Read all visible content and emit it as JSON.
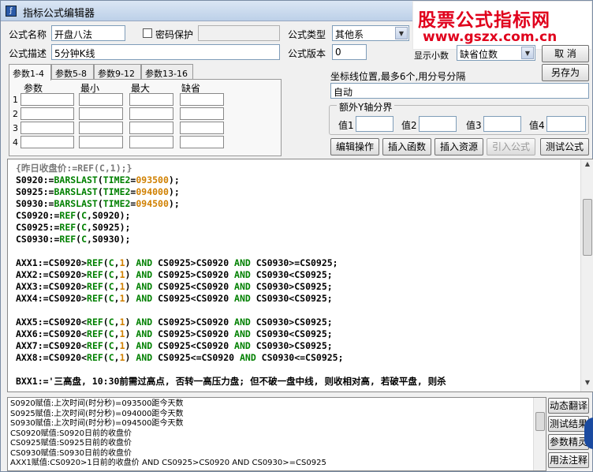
{
  "window": {
    "title": "指标公式编辑器"
  },
  "watermark": {
    "line1": "股票公式指标网",
    "line2": "www.gszx.com.cn"
  },
  "form": {
    "name_label": "公式名称",
    "name_value": "开盘八法",
    "password_label": "密码保护",
    "type_label": "公式类型",
    "type_value": "其他系",
    "desc_label": "公式描述",
    "desc_value": "5分钟K线",
    "version_label": "公式版本",
    "version_value": "0",
    "decimals_label": "显示小数",
    "decimals_value": "缺省位数",
    "cancel_label": "取 消",
    "saveas_label": "另存为"
  },
  "tabs": [
    {
      "label": "参数1-4"
    },
    {
      "label": "参数5-8"
    },
    {
      "label": "参数9-12"
    },
    {
      "label": "参数13-16"
    }
  ],
  "params": {
    "headers": [
      "参数",
      "最小",
      "最大",
      "缺省"
    ],
    "rows": [
      "1",
      "2",
      "3",
      "4"
    ]
  },
  "axis": {
    "label": "坐标线位置,最多6个,用分号分隔",
    "value": "自动",
    "extra_title": "额外Y轴分界",
    "v1": "值1",
    "v2": "值2",
    "v3": "值3",
    "v4": "值4"
  },
  "buttons": {
    "edit": "编辑操作",
    "insert_func": "插入函数",
    "insert_res": "插入资源",
    "import": "引入公式",
    "test": "测试公式"
  },
  "code": {
    "lines": [
      "{昨日收盘价:=REF(C,1);}",
      "S0920:=BARSLAST(TIME2=093500);",
      "S0925:=BARSLAST(TIME2=094000);",
      "S0930:=BARSLAST(TIME2=094500);",
      "CS0920:=REF(C,S0920);",
      "CS0925:=REF(C,S0925);",
      "CS0930:=REF(C,S0930);",
      "",
      "AXX1:=CS0920>REF(C,1) AND CS0925>CS0920 AND CS0930>=CS0925;",
      "AXX2:=CS0920>REF(C,1) AND CS0925>CS0920 AND CS0930<CS0925;",
      "AXX3:=CS0920>REF(C,1) AND CS0925<CS0920 AND CS0930>CS0925;",
      "AXX4:=CS0920>REF(C,1) AND CS0925<CS0920 AND CS0930<CS0925;",
      "",
      "AXX5:=CS0920<REF(C,1) AND CS0925>CS0920 AND CS0930>CS0925;",
      "AXX6:=CS0920<REF(C,1) AND CS0925>CS0920 AND CS0930<CS0925;",
      "AXX7:=CS0920<REF(C,1) AND CS0925<CS0920 AND CS0930>CS0925;",
      "AXX8:=CS0920<REF(C,1) AND CS0925<=CS0920 AND CS0930<=CS0925;",
      "",
      "BXX1:='三高盘, 10:30前需过高点, 否转一高压力盘; 但不破一盘中线, 则收相对高, 若破平盘, 则杀"
    ]
  },
  "output": {
    "lines": [
      "S0920赋值:上次时间(时分秒)=093500距今天数",
      "S0925赋值:上次时间(时分秒)=094000距今天数",
      "S0930赋值:上次时间(时分秒)=094500距今天数",
      "CS0920赋值:S0920日前的收盘价",
      "CS0925赋值:S0925日前的收盘价",
      "CS0930赋值:S0930日前的收盘价",
      "AXX1赋值:CS0920>1日前的收盘价 AND CS0925>CS0920 AND CS0930>=CS0925"
    ]
  },
  "side_buttons": [
    "动态翻译",
    "测试结果",
    "参数精灵",
    "用法注释"
  ],
  "colors": {
    "keyword_green": "#008000",
    "number_orange": "#d08000",
    "watermark_red": "#e0001c"
  }
}
